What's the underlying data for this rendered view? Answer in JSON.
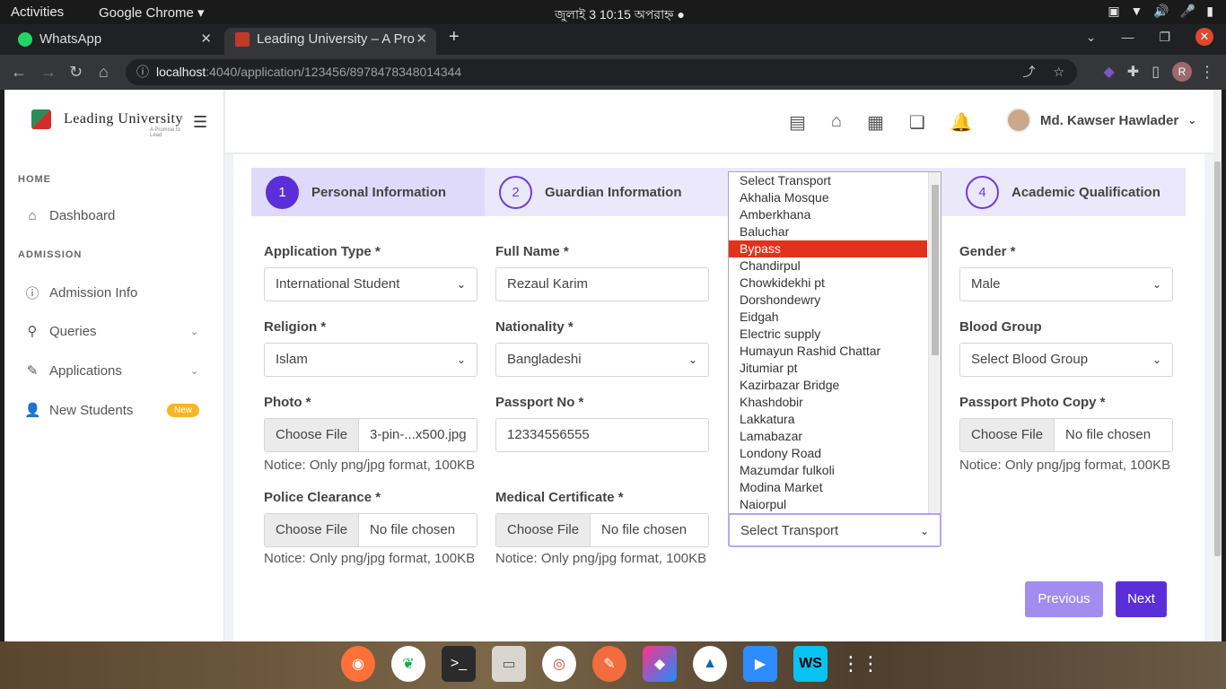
{
  "topbar": {
    "activities": "Activities",
    "browser": "Google Chrome ▾",
    "clock": "জুলাই 3  10:15 অপরাহ্ন  ●"
  },
  "tabs": [
    {
      "title": "WhatsApp",
      "close": "✕"
    },
    {
      "title": "Leading University – A Pro",
      "close": "✕"
    }
  ],
  "newtab": "+",
  "address": {
    "host": "localhost",
    "path": ":4040/application/123456/8978478348014344"
  },
  "brand": {
    "name": "Leading University",
    "tagline": "A Promise to Lead"
  },
  "sidebar": {
    "sections": [
      "HOME",
      "ADMISSION"
    ],
    "items": [
      {
        "label": "Dashboard",
        "icon": "⌂"
      },
      {
        "label": "Admission Info",
        "icon": "ⓘ"
      },
      {
        "label": "Queries",
        "icon": "⚲"
      },
      {
        "label": "Applications",
        "icon": "✎"
      },
      {
        "label": "New Students",
        "icon": "👤"
      }
    ],
    "badge": "New"
  },
  "user": {
    "name": "Md. Kawser Hawlader",
    "caret": "⌄"
  },
  "steps": [
    {
      "num": "1",
      "label": "Personal Information"
    },
    {
      "num": "2",
      "label": "Guardian Information"
    },
    {
      "num": "4",
      "label": "Academic Qualification"
    }
  ],
  "form": {
    "application_type": {
      "label": "Application Type *",
      "value": "International Student"
    },
    "full_name": {
      "label": "Full Name *",
      "value": "Rezaul Karim"
    },
    "gender": {
      "label": "Gender *",
      "value": "Male"
    },
    "religion": {
      "label": "Religion *",
      "value": "Islam"
    },
    "nationality": {
      "label": "Nationality *",
      "value": "Bangladeshi"
    },
    "blood_group": {
      "label": "Blood Group",
      "value": "Select Blood Group"
    },
    "photo": {
      "label": "Photo *",
      "button": "Choose File",
      "file": "3-pin-...x500.jpg",
      "notice": "Notice: Only png/jpg format, 100KB"
    },
    "passport_no": {
      "label": "Passport No *",
      "value": "12334556555"
    },
    "passport_copy": {
      "label": "Passport Photo Copy *",
      "button": "Choose File",
      "file": "No file chosen",
      "notice": "Notice: Only png/jpg format, 100KB"
    },
    "police_clearance": {
      "label": "Police Clearance *",
      "button": "Choose File",
      "file": "No file chosen",
      "notice": "Notice: Only png/jpg format, 100KB"
    },
    "medical_certificate": {
      "label": "Medical Certificate *",
      "button": "Choose File",
      "file": "No file chosen",
      "notice": "Notice: Only png/jpg format, 100KB"
    },
    "transport": {
      "value": "Select Transport"
    }
  },
  "transport_options": [
    "Select Transport",
    "Akhalia Mosque",
    "Amberkhana",
    "Baluchar",
    "Bypass",
    "Chandirpul",
    "Chowkidekhi pt",
    "Dorshondewry",
    "Eidgah",
    "Electric supply",
    "Humayun Rashid Chattar",
    "Jitumiar pt",
    "Kazirbazar Bridge",
    "Khashdobir",
    "Lakkatura",
    "Lamabazar",
    "Londony Road",
    "Mazumdar fulkoli",
    "Modina Market",
    "Naiorpul"
  ],
  "selected_transport": "Bypass",
  "buttons": {
    "previous": "Previous",
    "next": "Next"
  },
  "colors": {
    "primary": "#5b2fd8",
    "primary_light": "#a38cf0",
    "highlight": "#e1321d",
    "badge": "#f6b622"
  }
}
